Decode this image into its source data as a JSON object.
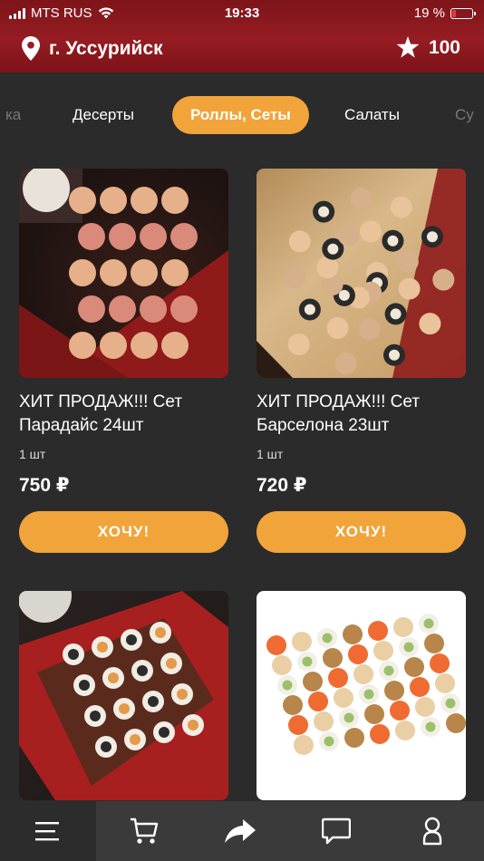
{
  "status_bar": {
    "carrier": "MTS RUS",
    "time": "19:33",
    "battery_text": "19 %",
    "battery_level": 0.19,
    "battery_color": "#e23a3a"
  },
  "location": {
    "city": "г. Уссурийск",
    "icon": "location-pin-icon"
  },
  "points": {
    "value": "100",
    "icon": "star-icon"
  },
  "categories": [
    {
      "label": "ка",
      "state": "faded"
    },
    {
      "label": "Десерты",
      "state": "normal"
    },
    {
      "label": "Роллы, Сеты",
      "state": "active"
    },
    {
      "label": "Салаты",
      "state": "normal"
    },
    {
      "label": "Су",
      "state": "faded"
    }
  ],
  "products": [
    {
      "name": "ХИТ ПРОДАЖ!!! Сет Парадайс 24шт",
      "qty": "1 шт",
      "price": "750 ₽",
      "button": "ХОЧУ!"
    },
    {
      "name": "ХИТ ПРОДАЖ!!! Сет Барселона 23шт",
      "qty": "1 шт",
      "price": "720 ₽",
      "button": "ХОЧУ!"
    },
    {
      "name": "",
      "qty": "",
      "price": "",
      "button": ""
    },
    {
      "name": "",
      "qty": "",
      "price": "",
      "button": ""
    }
  ],
  "bottom_nav": [
    {
      "icon": "menu-icon",
      "active": true
    },
    {
      "icon": "cart-icon",
      "active": false
    },
    {
      "icon": "share-icon",
      "active": false
    },
    {
      "icon": "chat-icon",
      "active": false
    },
    {
      "icon": "profile-icon",
      "active": false
    }
  ],
  "colors": {
    "accent": "#f1a43a",
    "header": "#951c22",
    "background": "#2b2b2b",
    "nav": "#3a3a3a"
  }
}
